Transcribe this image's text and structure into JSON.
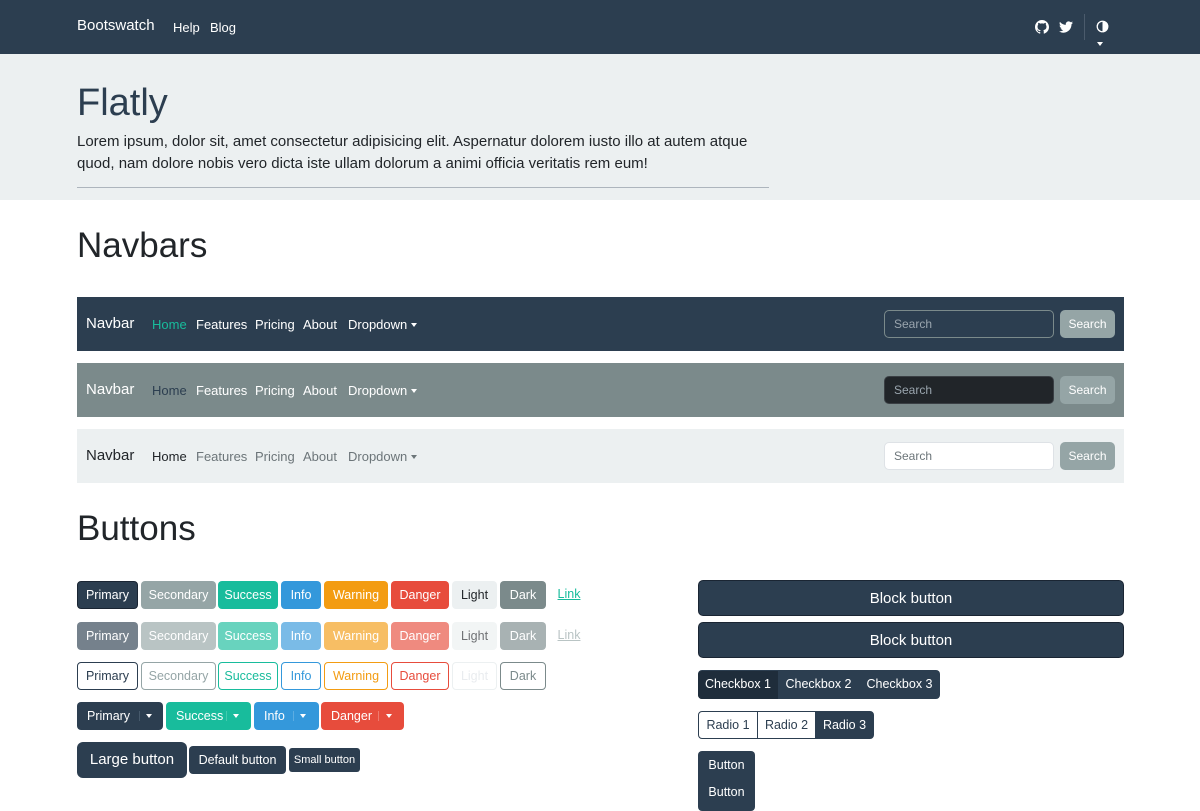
{
  "topnav": {
    "brand": "Bootswatch",
    "links": [
      "Help",
      "Blog"
    ],
    "icons": [
      "github-icon",
      "twitter-icon",
      "theme-toggle-icon"
    ]
  },
  "hero": {
    "title": "Flatly",
    "text": "Lorem ipsum, dolor sit, amet consectetur adipisicing elit. Aspernatur dolorem iusto illo at autem atque quod, nam dolore nobis vero dicta iste ullam dolorum a animi officia veritatis rem eum!"
  },
  "navbars": {
    "title": "Navbars",
    "brand": "Navbar",
    "links": [
      "Home",
      "Features",
      "Pricing",
      "About",
      "Dropdown"
    ],
    "search_placeholder": "Search",
    "search_button": "Search"
  },
  "buttons": {
    "title": "Buttons",
    "variants": [
      "Primary",
      "Secondary",
      "Success",
      "Info",
      "Warning",
      "Danger",
      "Light",
      "Dark",
      "Link"
    ],
    "split": [
      "Primary",
      "Success",
      "Info",
      "Danger"
    ],
    "sizes": [
      "Large button",
      "Default button",
      "Small button"
    ],
    "block": [
      "Block button",
      "Block button"
    ],
    "checkboxes": [
      "Checkbox 1",
      "Checkbox 2",
      "Checkbox 3"
    ],
    "radios": [
      "Radio 1",
      "Radio 2",
      "Radio 3"
    ],
    "vertical": [
      "Button",
      "Button"
    ]
  },
  "colors": {
    "primary": "#2c3e50",
    "secondary": "#95a5a6",
    "success": "#18bc9c",
    "info": "#3498db",
    "warning": "#f39c12",
    "danger": "#e74c3c",
    "light": "#ecf0f1",
    "dark": "#7b8a8b"
  }
}
